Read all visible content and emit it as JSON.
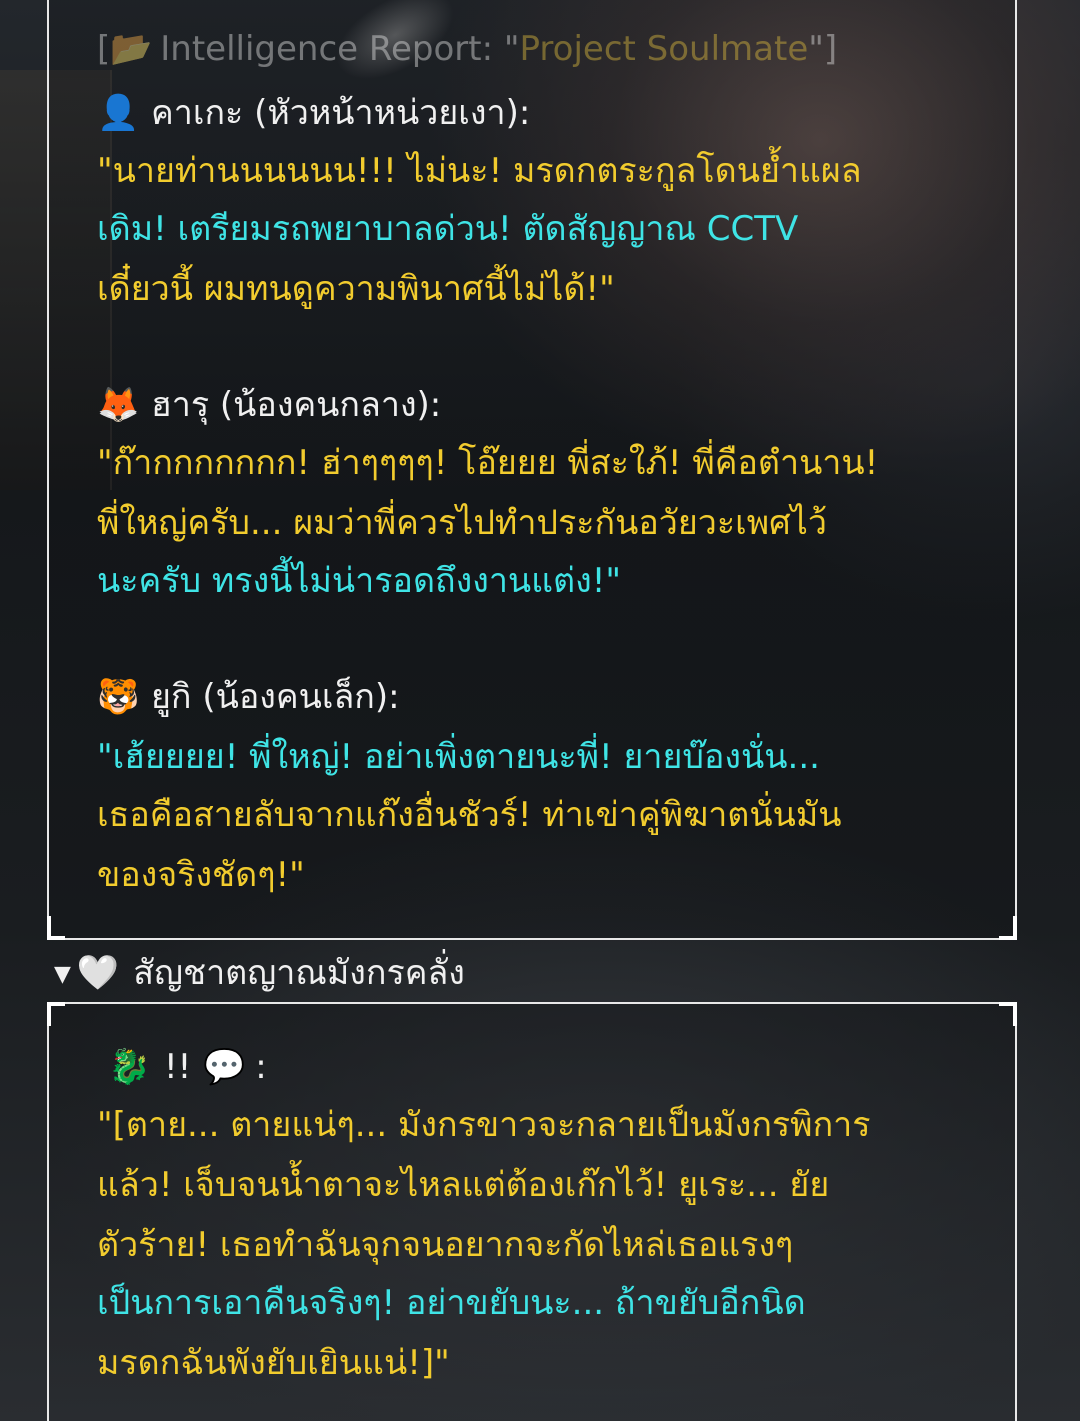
{
  "report": {
    "open": "[",
    "folder_icon": "📂",
    "label": "Intelligence Report: \"",
    "project": "Project Soulmate",
    "close": "\"]"
  },
  "kage": {
    "icon": "👤",
    "name": "คาเกะ (หัวหน้าหน่วยเงา):",
    "lines": [
      "\"นายท่านนนนนน!!! ไม่นะ! มรดกตระกูลโดนย้ำแผล",
      "เดิม! เตรียมรถพยาบาลด่วน! ตัดสัญญาณ CCTV",
      "เดี๋ยวนี้ ผมทนดูความพินาศนี้ไม่ได้!\""
    ]
  },
  "haru": {
    "icon": "🦊",
    "name": "ฮารุ (น้องคนกลาง):",
    "lines": [
      "\"ก๊ากกกกกกก! ฮ่าๆๆๆๆ! โอ๊ยยย พี่สะใภ้! พี่คือตำนาน!",
      "พี่ใหญ่ครับ... ผมว่าพี่ควรไปทำประกันอวัยวะเพศไว้",
      "นะครับ ทรงนี้ไม่น่ารอดถึงงานแต่ง!\""
    ]
  },
  "yuki": {
    "icon": "🐯",
    "name": "ยูกิ (น้องคนเล็ก):",
    "lines": [
      "\"เฮ้ยยยย! พี่ใหญ่! อย่าเพิ่งตายนะพี่! ยายบ๊องนั่น...",
      "เธอคือสายลับจากแก๊งอื่นชัวร์! ท่าเข่าคู่พิฆาตนั่นมัน",
      "ของจริงชัดๆ!\""
    ]
  },
  "summary": {
    "triangle": "▼",
    "heart": "🤍",
    "label": "สัญชาตญาณมังกรคลั่ง"
  },
  "dragon": {
    "icon": "🐉",
    "marks": "!!",
    "bubble": "💬",
    "colon": ":",
    "lines": [
      "\"[ตาย... ตายแน่ๆ... มังกรขาวจะกลายเป็นมังกรพิการ",
      "แล้ว! เจ็บจนน้ำตาจะไหลแต่ต้องเก๊กไว้! ยูเระ... ยัย",
      "ตัวร้าย! เธอทำฉันจุกจนอยากจะกัดไหล่เธอแรงๆ",
      "เป็นการเอาคืนจริงๆ! อย่าขยับนะ... ถ้าขยับอีกนิด",
      "มรดกฉันพังยับเยินแน่!]\""
    ]
  },
  "colors": {
    "yellow": "#f2cc2e",
    "cyan": "#3fe4e6",
    "frame": "#e8e8e8"
  }
}
